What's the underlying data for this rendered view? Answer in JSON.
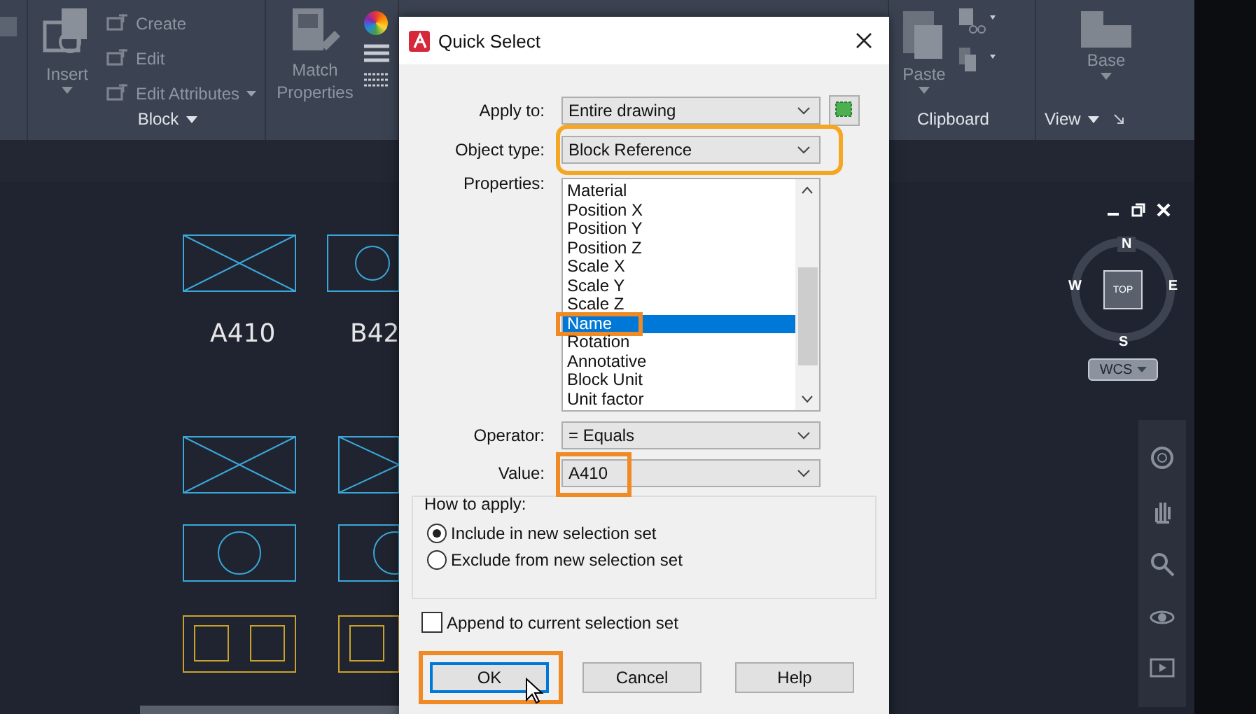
{
  "ribbon": {
    "insert_button": "Insert",
    "block_tools": [
      {
        "label": "Create",
        "dropdown": false
      },
      {
        "label": "Edit",
        "dropdown": false
      },
      {
        "label": "Edit Attributes",
        "dropdown": true
      }
    ],
    "block_panel": "Block",
    "match_properties": "Match Properties",
    "paste_button": "Paste",
    "clipboard_panel": "Clipboard",
    "base_button": "Base",
    "view_panel": "View"
  },
  "canvas": {
    "block_labels": [
      "A410",
      "B42"
    ]
  },
  "viewcube": {
    "top": "TOP",
    "north": "N",
    "south": "S",
    "east": "E",
    "west": "W"
  },
  "wcs_button": "WCS",
  "dialog": {
    "title": "Quick Select",
    "apply_to": {
      "label": "Apply to:",
      "value": "Entire drawing"
    },
    "object_type": {
      "label": "Object type:",
      "value": "Block Reference",
      "highlighted": true
    },
    "properties": {
      "label": "Properties:",
      "items": [
        {
          "text": "Material",
          "selected": false,
          "highlighted": false
        },
        {
          "text": "Position X",
          "selected": false,
          "highlighted": false
        },
        {
          "text": "Position Y",
          "selected": false,
          "highlighted": false
        },
        {
          "text": "Position Z",
          "selected": false,
          "highlighted": false
        },
        {
          "text": "Scale X",
          "selected": false,
          "highlighted": false
        },
        {
          "text": "Scale Y",
          "selected": false,
          "highlighted": false
        },
        {
          "text": "Scale Z",
          "selected": false,
          "highlighted": false
        },
        {
          "text": "Name",
          "selected": true,
          "highlighted": true
        },
        {
          "text": "Rotation",
          "selected": false,
          "highlighted": false
        },
        {
          "text": "Annotative",
          "selected": false,
          "highlighted": false
        },
        {
          "text": "Block Unit",
          "selected": false,
          "highlighted": false
        },
        {
          "text": "Unit factor",
          "selected": false,
          "highlighted": false
        }
      ]
    },
    "operator": {
      "label": "Operator:",
      "value": "= Equals"
    },
    "value": {
      "label": "Value:",
      "value": "A410",
      "highlighted": true
    },
    "how_to_apply": {
      "legend": "How to apply:",
      "options": [
        {
          "label": "Include in new selection set",
          "selected": true
        },
        {
          "label": "Exclude from new selection set",
          "selected": false
        }
      ]
    },
    "append": {
      "label": "Append to current selection set",
      "checked": false
    },
    "buttons": [
      {
        "label": "OK",
        "default": true,
        "highlighted": true
      },
      {
        "label": "Cancel",
        "default": false,
        "highlighted": false
      },
      {
        "label": "Help",
        "default": false,
        "highlighted": false
      }
    ]
  }
}
